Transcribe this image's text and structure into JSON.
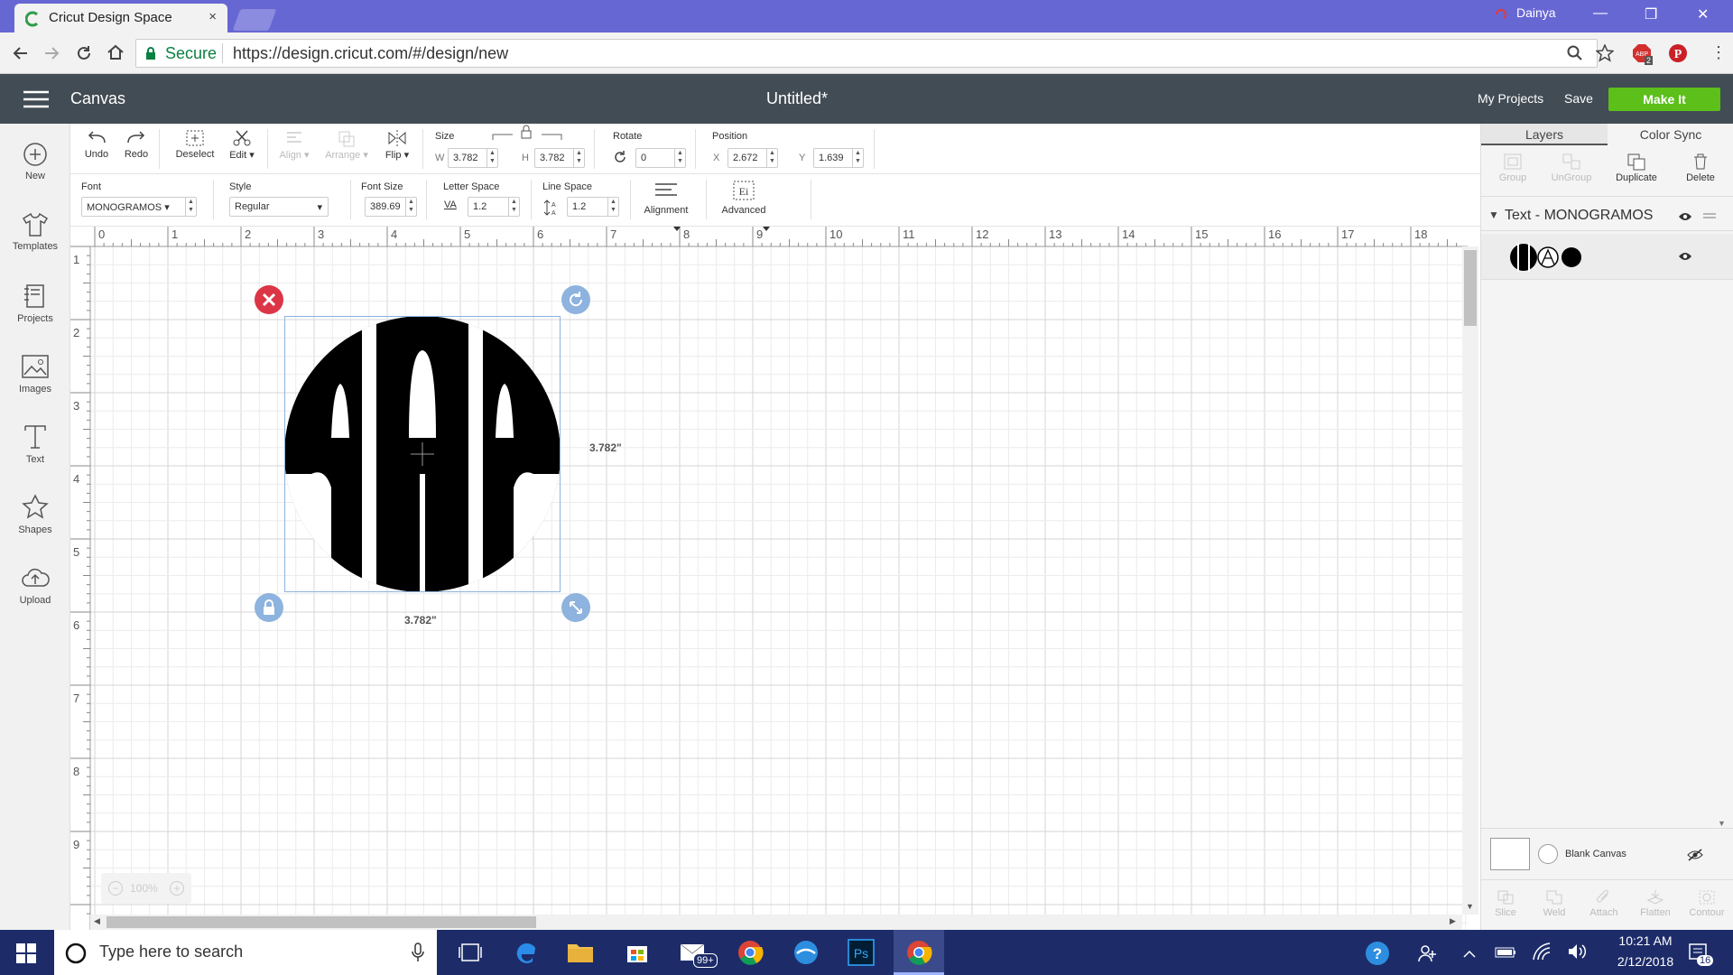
{
  "browser": {
    "tab_title": "Cricut Design Space",
    "tab_close": "×",
    "profile_name": "Dainya",
    "secure_label": "Secure",
    "url": "https://design.cricut.com/#/design/new",
    "extension_badge": "2"
  },
  "header": {
    "canvas_label": "Canvas",
    "doc_title": "Untitled*",
    "my_projects": "My Projects",
    "save": "Save",
    "make_it": "Make It"
  },
  "leftnav": {
    "items": [
      {
        "label": "New"
      },
      {
        "label": "Templates"
      },
      {
        "label": "Projects"
      },
      {
        "label": "Images"
      },
      {
        "label": "Text"
      },
      {
        "label": "Shapes"
      },
      {
        "label": "Upload"
      }
    ]
  },
  "toolbar": {
    "undo": "Undo",
    "redo": "Redo",
    "deselect": "Deselect",
    "edit": "Edit",
    "align": "Align",
    "arrange": "Arrange",
    "flip": "Flip",
    "size_label": "Size",
    "w_label": "W",
    "w_value": "3.782",
    "h_label": "H",
    "h_value": "3.782",
    "rotate_label": "Rotate",
    "rotate_value": "0",
    "position_label": "Position",
    "x_label": "X",
    "x_value": "2.672",
    "y_label": "Y",
    "y_value": "1.639"
  },
  "texttoolbar": {
    "font_label": "Font",
    "font_value": "MONOGRAMOS",
    "style_label": "Style",
    "style_value": "Regular",
    "fontsize_label": "Font Size",
    "fontsize_value": "389.69",
    "letterspace_label": "Letter Space",
    "letterspace_value": "1.2",
    "linespace_label": "Line Space",
    "linespace_value": "1.2",
    "alignment": "Alignment",
    "advanced": "Advanced"
  },
  "canvas": {
    "ruler_h": [
      "0",
      "1",
      "2",
      "3",
      "4",
      "5",
      "6",
      "7",
      "8",
      "9",
      "10",
      "11",
      "12",
      "13",
      "14",
      "15",
      "16",
      "17",
      "18"
    ],
    "ruler_v": [
      "1",
      "2",
      "3",
      "4",
      "5",
      "6",
      "7",
      "8",
      "9"
    ],
    "height_dim": "3.782\"",
    "width_dim": "3.782\"",
    "zoom": "100%"
  },
  "rightpanel": {
    "tab_layers": "Layers",
    "tab_colorsync": "Color Sync",
    "group": "Group",
    "ungroup": "UnGroup",
    "duplicate": "Duplicate",
    "delete": "Delete",
    "layer_name": "Text - MONOGRAMOS",
    "blank_canvas": "Blank Canvas",
    "slice": "Slice",
    "weld": "Weld",
    "attach": "Attach",
    "flatten": "Flatten",
    "contour": "Contour"
  },
  "taskbar": {
    "search_placeholder": "Type here to search",
    "mail_badge": "99+",
    "time": "10:21 AM",
    "date": "2/12/2018",
    "notifications": "16"
  },
  "colors": {
    "titlebar": "#6767d4",
    "app_header": "#424c54",
    "make_it": "#5cbf1a",
    "selection": "#8db3de",
    "delete_handle": "#dc3545",
    "taskbar": "#1d2c69"
  }
}
